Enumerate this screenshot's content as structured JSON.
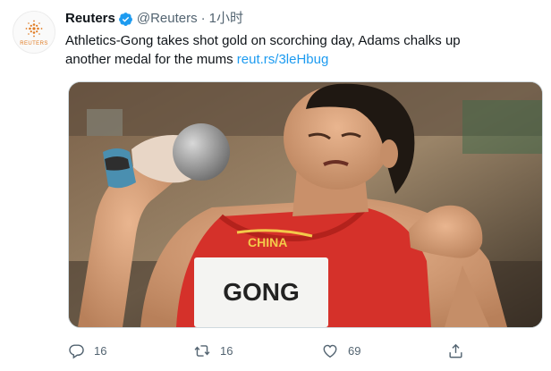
{
  "account": {
    "name": "Reuters",
    "handle": "@Reuters",
    "separator": "·",
    "time": "1小时",
    "avatar_label": "REUTERS"
  },
  "tweet": {
    "text_line1": "Athletics-Gong takes shot gold on scorching day, Adams chalks up",
    "text_line2": "another medal for the mums",
    "link_text": "reut.rs/3leHbug"
  },
  "media": {
    "bib_text": "GONG",
    "jersey_text": "CHINA"
  },
  "actions": {
    "reply_count": "16",
    "retweet_count": "16",
    "like_count": "69"
  },
  "colors": {
    "link": "#1d9bf0",
    "muted": "#536471",
    "verified": "#1d9bf0",
    "brand": "#e07b22",
    "jersey": "#d5312a"
  },
  "icons": {
    "verified": "verified-badge-icon",
    "more": "more-dots-icon",
    "reply": "reply-icon",
    "retweet": "retweet-icon",
    "like": "heart-icon",
    "share": "share-icon",
    "logo": "reuters-dot-logo-icon"
  }
}
